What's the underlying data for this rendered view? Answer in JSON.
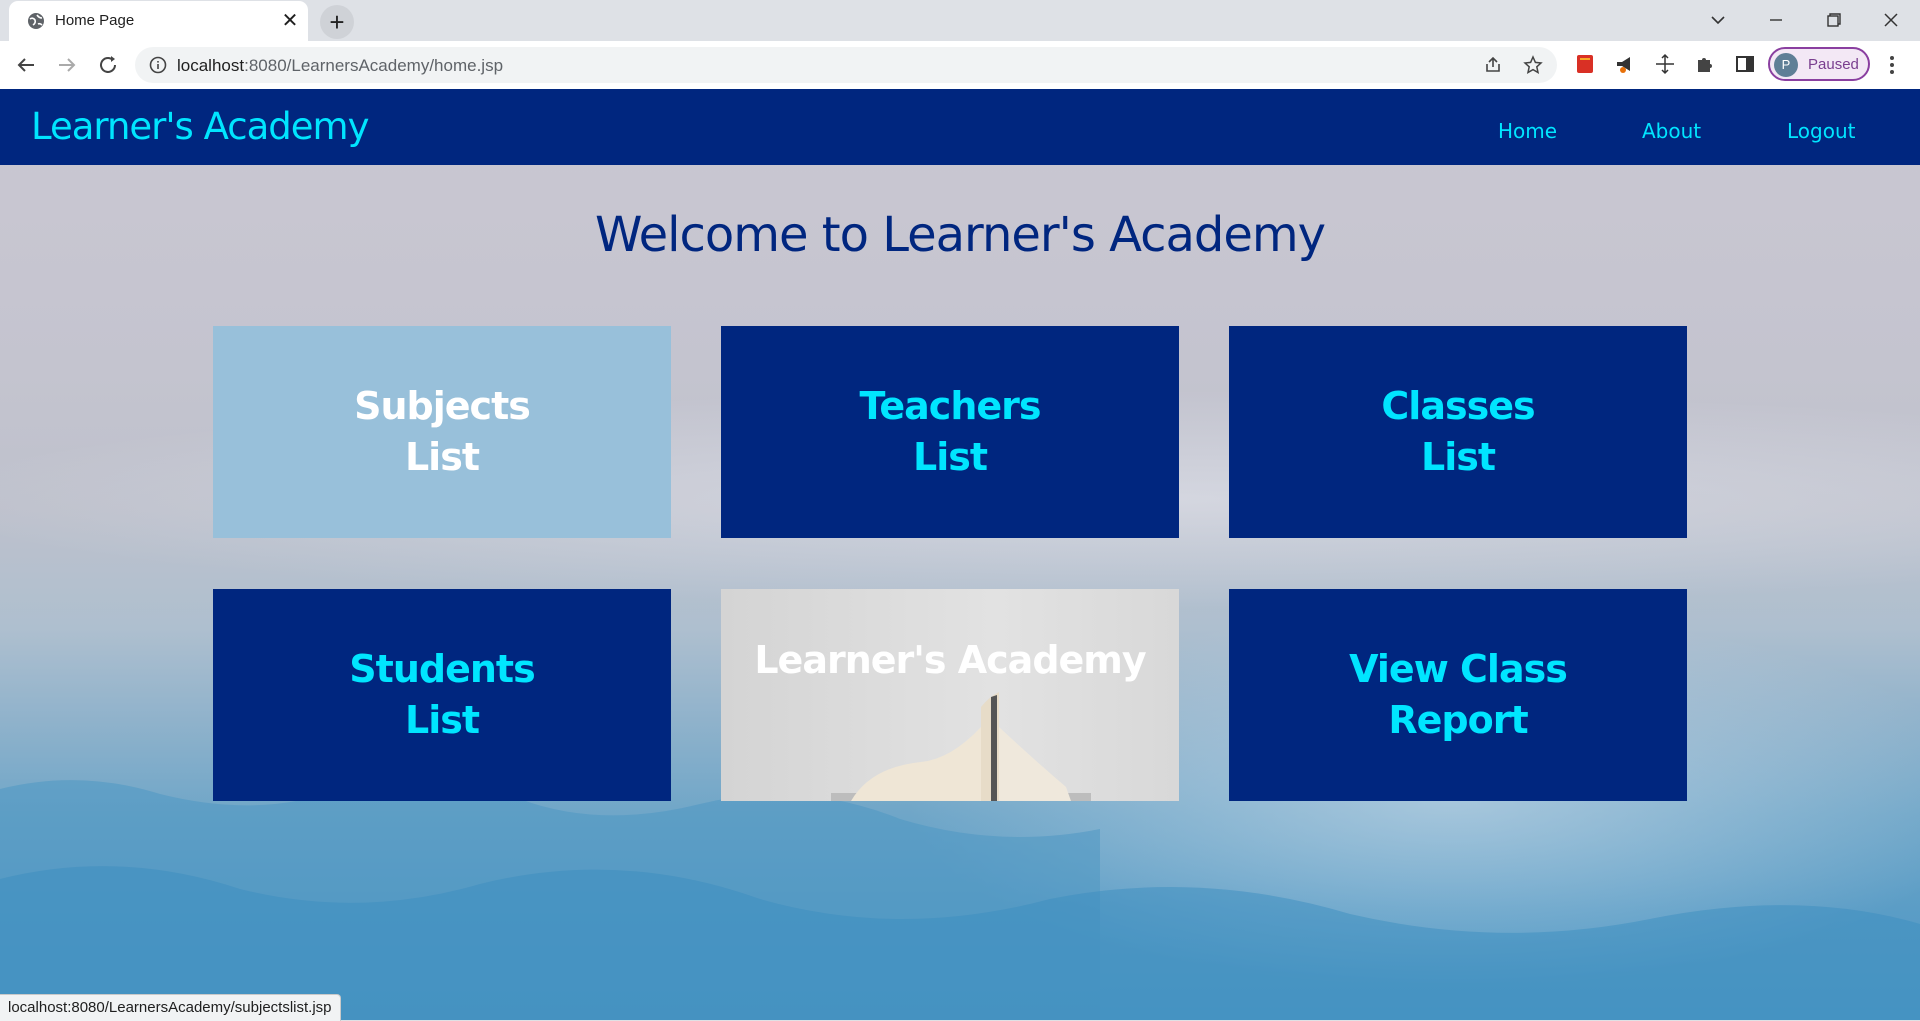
{
  "browser": {
    "tab_title": "Home Page",
    "url_host": "localhost",
    "url_rest": ":8080/LearnersAcademy/home.jsp",
    "profile_initial": "P",
    "profile_status": "Paused",
    "status_bar_url": "localhost:8080/LearnersAcademy/subjectslist.jsp"
  },
  "navbar": {
    "brand": "Learner's Academy",
    "links": [
      "Home",
      "About",
      "Logout"
    ]
  },
  "main": {
    "heading": "Welcome to Learner's Academy",
    "tiles": [
      {
        "label": "Subjects\nList"
      },
      {
        "label": "Teachers\nList"
      },
      {
        "label": "Classes\nList"
      },
      {
        "label": "Students\nList"
      },
      {
        "label": "Learner's Academy"
      },
      {
        "label": "View Class\nReport"
      }
    ]
  },
  "colors": {
    "navbar_bg": "#00267f",
    "accent_cyan": "#00e5ff",
    "tile_bg": "#00267f",
    "tile_hover_bg": "#98c0da",
    "heading": "#00267f"
  },
  "icons": [
    "globe-icon",
    "close-icon",
    "plus-icon",
    "chevron-down-icon",
    "minimize-icon",
    "restore-icon",
    "window-close-icon",
    "back-icon",
    "forward-icon",
    "reload-icon",
    "info-icon",
    "share-icon",
    "star-icon",
    "extension-icon",
    "puzzle-icon",
    "sidepanel-icon",
    "kebab-menu-icon"
  ]
}
